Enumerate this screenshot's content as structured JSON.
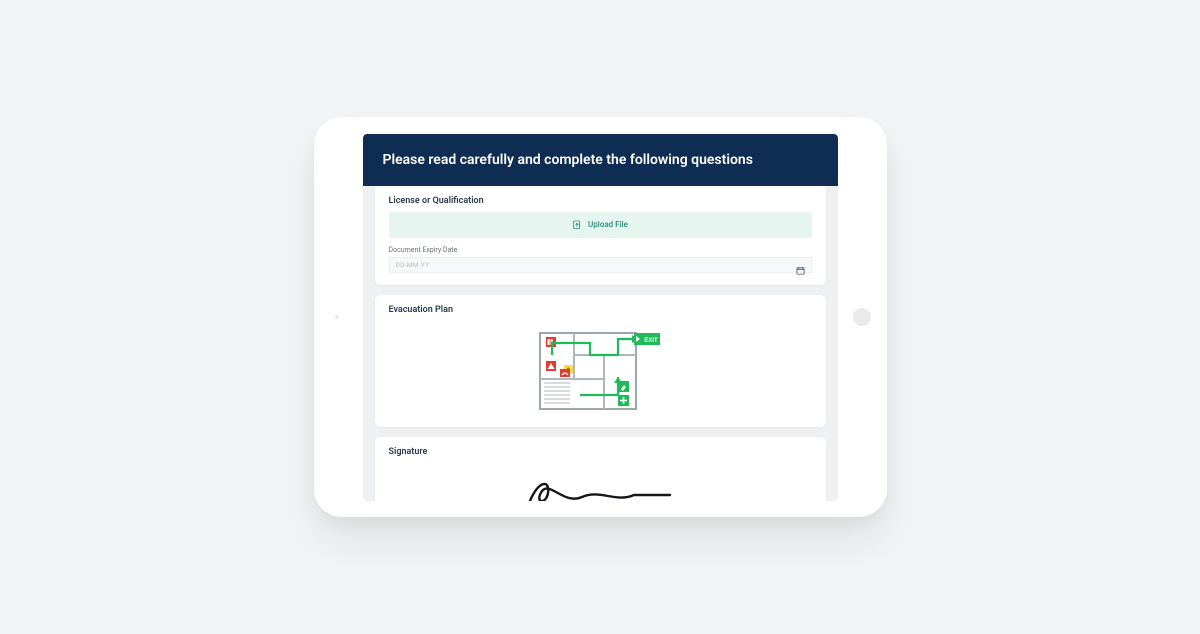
{
  "header": {
    "title": "Please read carefully and complete the following questions"
  },
  "sections": {
    "license": {
      "title": "License or Qualification",
      "upload_label": "Upload File",
      "expiry_label": "Document Expiry Date",
      "expiry_placeholder": "DD-MM-YY"
    },
    "evacuation": {
      "title": "Evacuation Plan",
      "exit_label": "EXIT"
    },
    "signature": {
      "title": "Signature"
    }
  }
}
